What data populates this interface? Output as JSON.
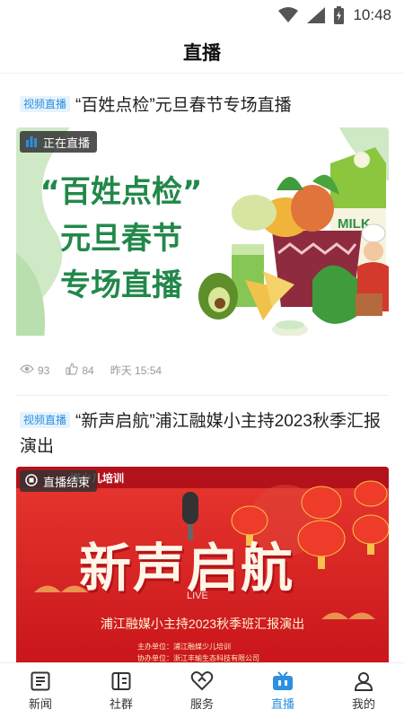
{
  "status_bar": {
    "time": "10:48"
  },
  "header": {
    "title": "直播"
  },
  "feed": [
    {
      "tag": "视频直播",
      "title": "“百姓点检”元旦春节专场直播",
      "badge": "正在直播",
      "cover_lines": [
        "“百姓点检”",
        "元旦春节",
        "专场直播"
      ],
      "cover_milk": "MILK",
      "views": "93",
      "likes": "84",
      "time": "昨天 15:54"
    },
    {
      "tag": "视频直播",
      "title": "“新声启航”浦江融媒小主持2023秋季汇报演出",
      "badge": "直播结束",
      "cover_top_text": "媒少儿培训",
      "cover_title": "新声启航",
      "cover_subtitle": "浦江融媒小主持2023秋季班汇报演出",
      "cover_org_1": "主办单位：浦江融媒少儿培训",
      "cover_org_2": "协办单位：浙江丰瑜生态科技有限公司"
    }
  ],
  "watermark": "LIVE",
  "tabbar": {
    "active": "直播",
    "items": [
      {
        "label": "新闻",
        "icon": "news-icon"
      },
      {
        "label": "社群",
        "icon": "community-icon"
      },
      {
        "label": "服务",
        "icon": "service-icon"
      },
      {
        "label": "直播",
        "icon": "live-tv-icon"
      },
      {
        "label": "我的",
        "icon": "profile-icon"
      }
    ]
  },
  "colors": {
    "accent": "#2c8fe0",
    "cover1_green": "#22884a",
    "cover2_red": "#d61f22"
  }
}
